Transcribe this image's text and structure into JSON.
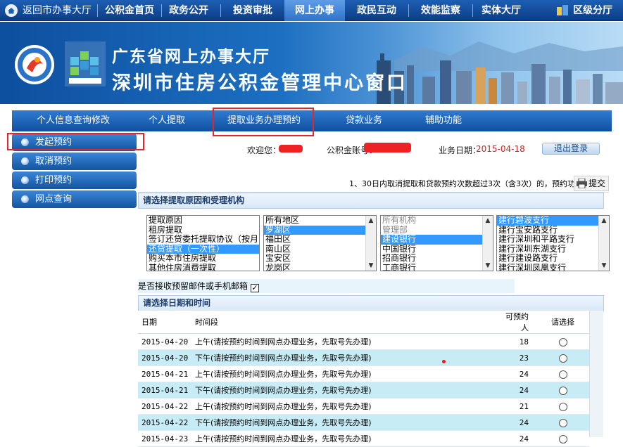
{
  "topnav": {
    "back": "返回市办事大厅",
    "items": [
      "公积金首页",
      "政务公开",
      "投资审批",
      "网上办事",
      "政民互动",
      "效能监察",
      "实体大厅"
    ],
    "right": "区级分厅"
  },
  "banner": {
    "title1": "广东省网上办事大厅",
    "title2": "深圳市住房公积金管理中心窗口"
  },
  "subnav": [
    "个人信息查询修改",
    "个人提取",
    "提取业务办理预约",
    "贷款业务",
    "辅助功能"
  ],
  "sidebar": [
    "发起预约",
    "取消预约",
    "打印预约",
    "网点查询"
  ],
  "userbar": {
    "welcome": "欢迎您：",
    "account": "公积金账号：",
    "date_label": "业务日期：",
    "date": "2015-04-18",
    "logout": "退出登录"
  },
  "notice": "1、30日内取消提取和贷款预约次数超过3次（含3次）的，预约功能",
  "submit": "提交",
  "select_section": "请选择提取原因和受理机构",
  "reasons": [
    "提取原因",
    "租房提取",
    "签订还贷委托提取协议（按月",
    "还贷提取（一次性）",
    "购买本市住房提取",
    "其他住房消费提取"
  ],
  "districts": [
    "所有地区",
    "罗湖区",
    "福田区",
    "南山区",
    "宝安区",
    "龙岗区"
  ],
  "agencies": [
    "所有机构",
    "管理部",
    "建设银行",
    "中国银行",
    "招商银行",
    "工商银行"
  ],
  "branches": [
    "建行碧波支行",
    "建行宝安路支行",
    "建行深圳和平路支行",
    "建行深圳东湖支行",
    "建行建设路支行",
    "建行深圳凤凰支行"
  ],
  "email_label": "是否接收预留邮件或手机邮箱",
  "email_checked": "✓",
  "datetime_section": "请选择日期和时间",
  "table": {
    "headers": [
      "日期",
      "时间段",
      "可预约人",
      "请选择"
    ],
    "rows": [
      [
        "2015-04-20",
        "上午(请按预约时间到网点办理业务，先取号先办理)",
        "18"
      ],
      [
        "2015-04-20",
        "下午(请按预约时间到网点办理业务，先取号先办理)",
        "23"
      ],
      [
        "2015-04-21",
        "上午(请按预约时间到网点办理业务，先取号先办理)",
        "24"
      ],
      [
        "2015-04-21",
        "下午(请按预约时间到网点办理业务，先取号先办理)",
        "24"
      ],
      [
        "2015-04-22",
        "上午(请按预约时间到网点办理业务，先取号先办理)",
        "21"
      ],
      [
        "2015-04-22",
        "下午(请按预约时间到网点办理业务，先取号先办理)",
        "24"
      ],
      [
        "2015-04-23",
        "上午(请按预约时间到网点办理业务，先取号先办理)",
        "24"
      ]
    ]
  },
  "colors": {
    "nav_dark": "#0c3d86",
    "nav_active": "#2f73c9",
    "date_red": "#d42020",
    "row_alt": "#c8ecf6",
    "highlight": "#e2262b"
  }
}
